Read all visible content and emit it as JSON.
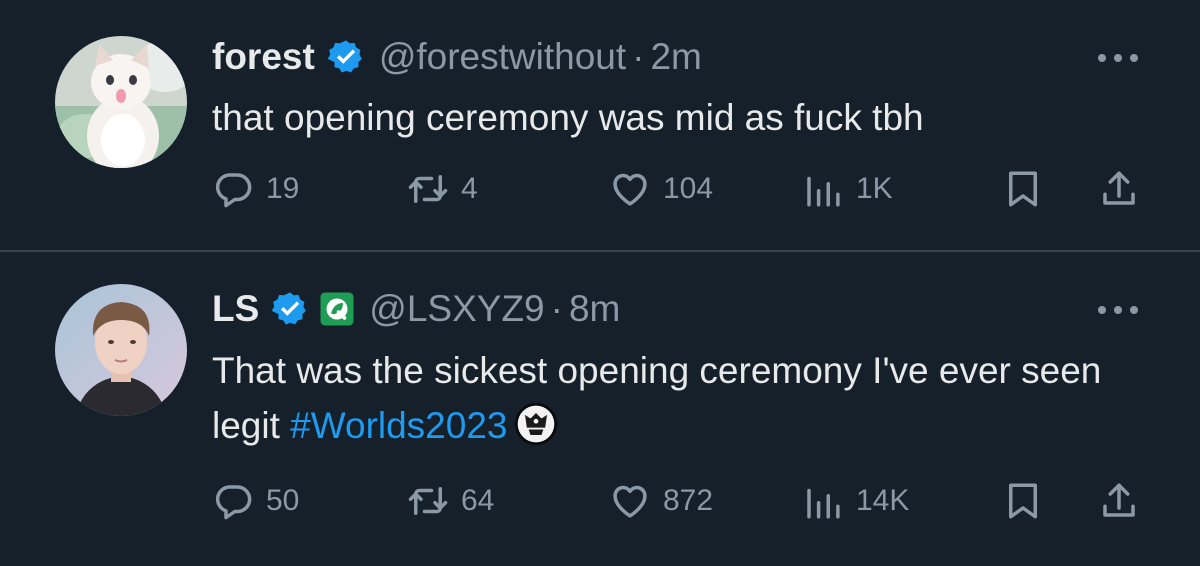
{
  "tweets": [
    {
      "name": "forest",
      "handle": "@forestwithout",
      "separator": "·",
      "time": "2m",
      "text": "that opening ceremony was mid as fuck tbh",
      "replies": "19",
      "retweets": "4",
      "likes": "104",
      "views": "1K",
      "verified": true,
      "avatar": "white-cat-photo"
    },
    {
      "name": "LS",
      "handle": "@LSXYZ9",
      "separator": "·",
      "time": "8m",
      "text_part1": "That was the sickest opening ceremony I've ever seen legit ",
      "hashtag": "#Worlds2023",
      "replies": "50",
      "retweets": "64",
      "likes": "872",
      "views": "14K",
      "verified": true,
      "affiliate_badge": "green-leaf-q-badge",
      "avatar": "young-man-photo",
      "emoji": "worlds-trophy-emoji"
    }
  ],
  "colors": {
    "background": "#15202b",
    "text": "#e7e9ea",
    "muted": "#8b98a5",
    "accent": "#1d9bf0",
    "divider": "#38444d"
  }
}
